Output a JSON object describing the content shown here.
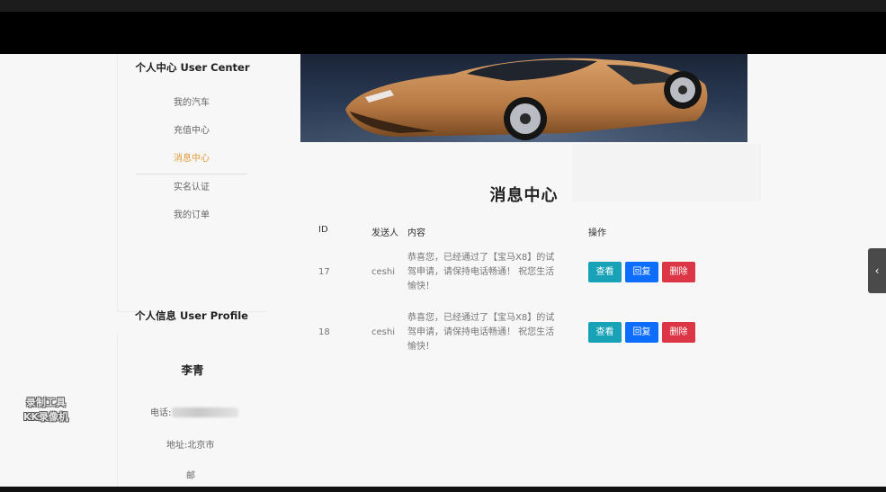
{
  "user_center": {
    "title": "个人中心 User Center",
    "menu": [
      {
        "label": "我的汽车",
        "active": false
      },
      {
        "label": "充值中心",
        "active": false
      },
      {
        "label": "消息中心",
        "active": true
      },
      {
        "label": "实名认证",
        "active": false
      },
      {
        "label": "我的订单",
        "active": false
      }
    ]
  },
  "user_profile": {
    "title": "个人信息 User Profile",
    "name": "李青",
    "phone_label": "电话:",
    "address": "地址:北京市",
    "email_label": "邮"
  },
  "watermark": {
    "line1": "录制工具",
    "line2": "KK录像机"
  },
  "main": {
    "title": "消息中心",
    "columns": [
      "ID",
      "发送人",
      "内容",
      "操作"
    ],
    "rows": [
      {
        "id": "17",
        "sender": "ceshi",
        "content": "恭喜您，已经通过了【宝马X8】的试驾申请，请保持电话畅通！ 祝您生活愉快！"
      },
      {
        "id": "18",
        "sender": "ceshi",
        "content": "恭喜您，已经通过了【宝马X8】的试驾申请，请保持电话畅通！ 祝您生活愉快！"
      }
    ],
    "actions": {
      "view": "查看",
      "reply": "回复",
      "delete": "删除"
    }
  },
  "colors": {
    "accent_active": "#e39a3b",
    "view": "#17a2b8",
    "reply": "#0d6efd",
    "delete": "#dc3545"
  },
  "icons": {
    "side_toggle": "chevron-left-icon"
  }
}
